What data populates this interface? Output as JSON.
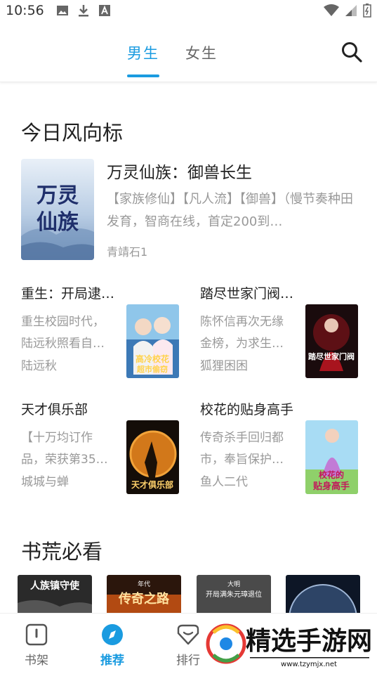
{
  "status": {
    "time": "10:56"
  },
  "tabs": [
    {
      "label": "男生",
      "active": true
    },
    {
      "label": "女生",
      "active": false
    }
  ],
  "icons": {
    "search": "search-icon"
  },
  "accent_color": "#1a9be0",
  "today": {
    "title": "今日风向标",
    "hero": {
      "title": "万灵仙族：御兽长生",
      "desc": "【家族修仙】【凡人流】【御兽】（慢节奏种田发育，智商在线，首定200到…",
      "author": "青靖石1",
      "cover_text": "万灵仙族"
    },
    "books": [
      {
        "title": "重生：开局逮…",
        "desc": "重生校园时代，陆远秋照看自…",
        "author": "陆远秋",
        "cover_text": "高冷校花超市偷窃"
      },
      {
        "title": "踏尽世家门阀…",
        "desc": "陈怀信再次无缘金榜，为求生…",
        "author": "狐狸困困",
        "cover_text": "踏尽世家门阀"
      },
      {
        "title": "天才俱乐部",
        "desc": "【十万均订作品，荣获第35…",
        "author": "城城与蝉",
        "cover_text": "天才俱乐部"
      },
      {
        "title": "校花的贴身高手",
        "desc": "传奇杀手回归都市，奉旨保护…",
        "author": "鱼人二代",
        "cover_text": "校花的贴身高手"
      }
    ]
  },
  "must_read": {
    "title": "书荒必看",
    "covers": [
      {
        "text": "人族镇守使"
      },
      {
        "text": "传奇之路",
        "sub": "年代"
      },
      {
        "text": "开局满朱元璋退位",
        "sub": "大明"
      },
      {
        "text": ""
      }
    ]
  },
  "bottom_nav": [
    {
      "label": "书架",
      "icon": "bookshelf-icon",
      "active": false
    },
    {
      "label": "推荐",
      "icon": "compass-icon",
      "active": true
    },
    {
      "label": "排行",
      "icon": "ranking-icon",
      "active": false
    }
  ],
  "watermark": {
    "title": "精选手游网",
    "url": "www.tzymjx.net"
  }
}
